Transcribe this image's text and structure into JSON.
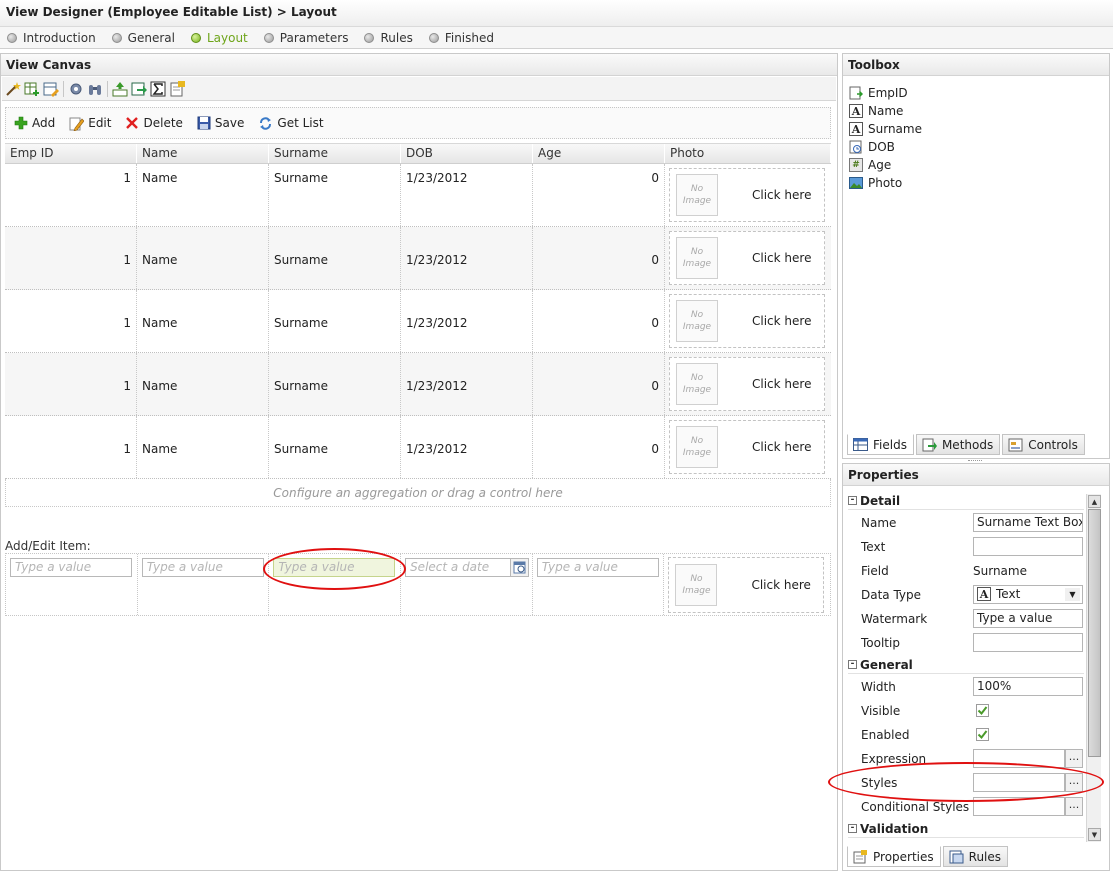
{
  "title": "View Designer (Employee Editable List) > Layout",
  "steps": [
    {
      "label": "Introduction"
    },
    {
      "label": "General"
    },
    {
      "label": "Layout"
    },
    {
      "label": "Parameters"
    },
    {
      "label": "Rules"
    },
    {
      "label": "Finished"
    }
  ],
  "active_step": "Layout",
  "canvas": {
    "title": "View Canvas",
    "actions": {
      "add": "Add",
      "edit": "Edit",
      "delete": "Delete",
      "save": "Save",
      "get_list": "Get List"
    },
    "columns": [
      "Emp ID",
      "Name",
      "Surname",
      "DOB",
      "Age",
      "Photo"
    ],
    "rows": [
      {
        "emp_id": "1",
        "name": "Name",
        "surname": "Surname",
        "dob": "1/23/2012",
        "age": "0"
      },
      {
        "emp_id": "1",
        "name": "Name",
        "surname": "Surname",
        "dob": "1/23/2012",
        "age": "0"
      },
      {
        "emp_id": "1",
        "name": "Name",
        "surname": "Surname",
        "dob": "1/23/2012",
        "age": "0"
      },
      {
        "emp_id": "1",
        "name": "Name",
        "surname": "Surname",
        "dob": "1/23/2012",
        "age": "0"
      },
      {
        "emp_id": "1",
        "name": "Name",
        "surname": "Surname",
        "dob": "1/23/2012",
        "age": "0"
      }
    ],
    "no_image_line1": "No",
    "no_image_line2": "Image",
    "click_here": "Click here",
    "footer_hint": "Configure an aggregation or drag a control here",
    "add_edit_label": "Add/Edit Item:",
    "placeholders": {
      "text": "Type a value",
      "date": "Select a date"
    }
  },
  "toolbox": {
    "title": "Toolbox",
    "items": [
      {
        "label": "EmpID",
        "icon": "autonumber-icon"
      },
      {
        "label": "Name",
        "icon": "text-icon"
      },
      {
        "label": "Surname",
        "icon": "text-icon"
      },
      {
        "label": "DOB",
        "icon": "date-icon"
      },
      {
        "label": "Age",
        "icon": "number-icon"
      },
      {
        "label": "Photo",
        "icon": "image-icon"
      }
    ],
    "tabs": {
      "fields": "Fields",
      "methods": "Methods",
      "controls": "Controls"
    }
  },
  "properties": {
    "title": "Properties",
    "sections": {
      "detail": "Detail",
      "general": "General",
      "validation": "Validation"
    },
    "labels": {
      "name": "Name",
      "text": "Text",
      "field": "Field",
      "data_type": "Data Type",
      "watermark": "Watermark",
      "tooltip": "Tooltip",
      "width": "Width",
      "visible": "Visible",
      "enabled": "Enabled",
      "expression": "Expression",
      "styles": "Styles",
      "conditional_styles": "Conditional Styles"
    },
    "values": {
      "name": "Surname Text Box",
      "text": "",
      "field": "Surname",
      "data_type": "Text",
      "watermark": "Type a value",
      "tooltip": "",
      "width": "100%",
      "visible": true,
      "enabled": true,
      "expression": "",
      "styles": "",
      "conditional_styles": ""
    },
    "ellipsis": "...",
    "tabs": {
      "properties": "Properties",
      "rules": "Rules"
    }
  },
  "colors": {
    "accent_green": "#6ea51a",
    "highlight_oval": "#e01010"
  }
}
